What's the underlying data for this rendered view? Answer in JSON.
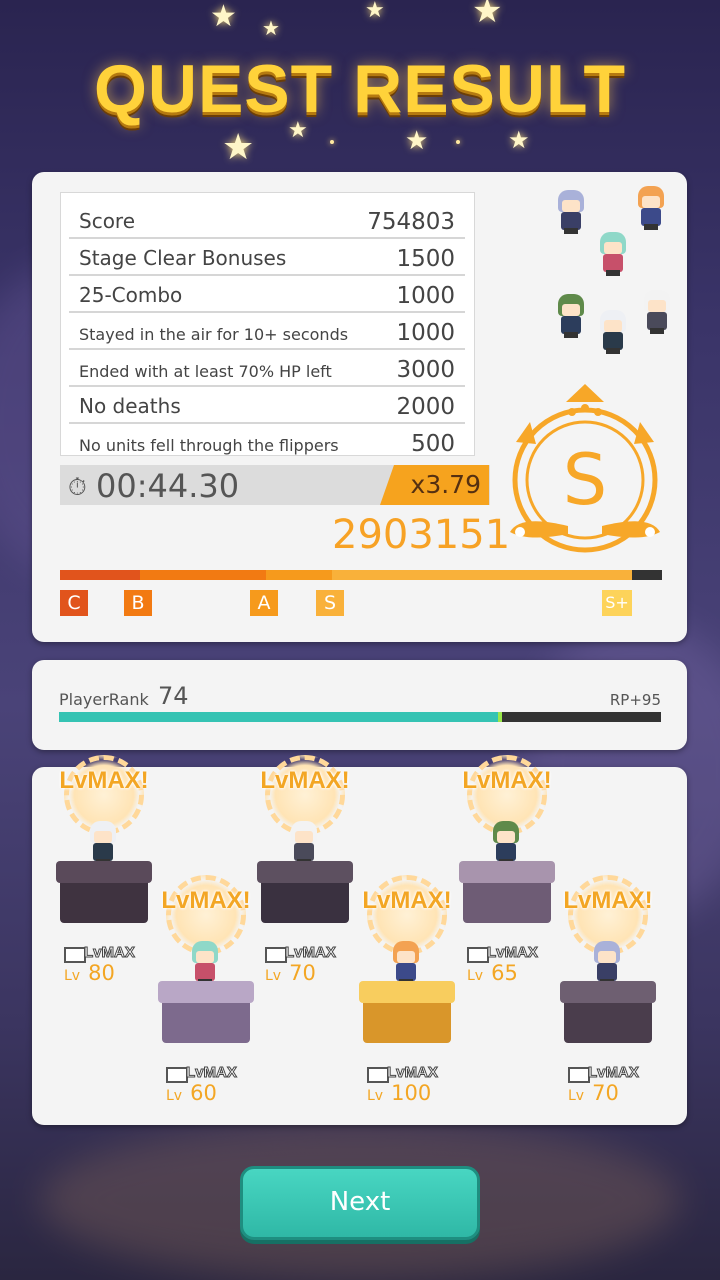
{
  "header": {
    "title": "QUEST RESULT"
  },
  "score_table": {
    "rows": [
      {
        "label": "Score",
        "value": "754803",
        "small": false
      },
      {
        "label": "Stage Clear Bonuses",
        "value": "1500",
        "small": false
      },
      {
        "label": "25-Combo",
        "value": "1000",
        "small": false
      },
      {
        "label": "Stayed in the air for 10+ seconds",
        "value": "1000",
        "small": true
      },
      {
        "label": "Ended with at least 70% HP left",
        "value": "3000",
        "small": true
      },
      {
        "label": "No deaths",
        "value": "2000",
        "small": false
      },
      {
        "label": "No units fell through the flippers",
        "value": "500",
        "small": true
      }
    ]
  },
  "time": {
    "clock_icon": "stopwatch-icon",
    "value": "00:44.30"
  },
  "multiplier": "x3.79",
  "total_score": "2903151",
  "rank_grade": "S",
  "grades": [
    {
      "label": "C",
      "color": "#e1541c"
    },
    {
      "label": "B",
      "color": "#f27a12"
    },
    {
      "label": "A",
      "color": "#f69a1c"
    },
    {
      "label": "S",
      "color": "#f9b13a"
    },
    {
      "label": "S+",
      "color": "#fdd35a"
    }
  ],
  "player": {
    "rank_label": "PlayerRank",
    "rank_value": "74",
    "rp_gain": "RP+95",
    "rp_progress": 0.73
  },
  "units": [
    {
      "lvmax_big": "LvMAX!",
      "lvmax_small": "LvMAX",
      "lv_word": "Lv",
      "level": "80",
      "hair": "#eef0f4",
      "body": "#2a3a4a",
      "ped_top": "#5a4a5a",
      "ped_side": "#3f3340"
    },
    {
      "lvmax_big": "LvMAX!",
      "lvmax_small": "LvMAX",
      "lv_word": "Lv",
      "level": "60",
      "hair": "#8fd8c8",
      "body": "#c7506a",
      "ped_top": "#b9a7c6",
      "ped_side": "#7d6a8d"
    },
    {
      "lvmax_big": "LvMAX!",
      "lvmax_small": "LvMAX",
      "lv_word": "Lv",
      "level": "70",
      "hair": "#f3f3f3",
      "body": "#4a4a5a",
      "ped_top": "#5d5060",
      "ped_side": "#3a3140"
    },
    {
      "lvmax_big": "LvMAX!",
      "lvmax_small": "LvMAX",
      "lv_word": "Lv",
      "level": "100",
      "hair": "#f3a252",
      "body": "#3c4a8a",
      "ped_top": "#f8cd5e",
      "ped_side": "#d9962a"
    },
    {
      "lvmax_big": "LvMAX!",
      "lvmax_small": "LvMAX",
      "lv_word": "Lv",
      "level": "65",
      "hair": "#5f8a4a",
      "body": "#2c3d5c",
      "ped_top": "#a894ad",
      "ped_side": "#6e5c75"
    },
    {
      "lvmax_big": "LvMAX!",
      "lvmax_small": "LvMAX",
      "lv_word": "Lv",
      "level": "70",
      "hair": "#a9b1d9",
      "body": "#3a3f66",
      "ped_top": "#6e5f71",
      "ped_side": "#4a3d4c"
    }
  ],
  "next_button": {
    "label": "Next"
  }
}
